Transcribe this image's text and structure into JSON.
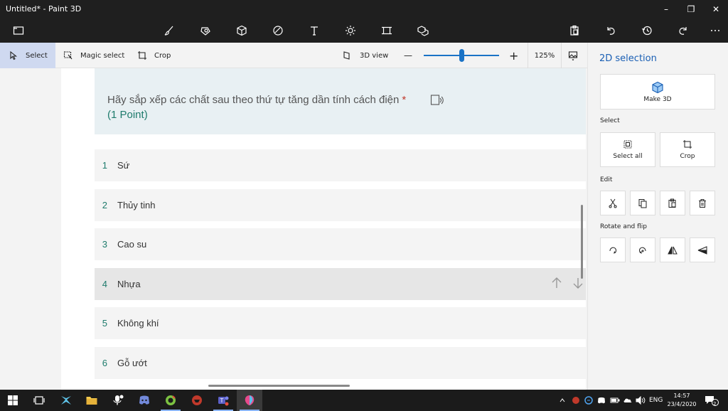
{
  "window": {
    "title": "Untitled* - Paint 3D",
    "minimize": "–",
    "restore": "❐",
    "close": "✕"
  },
  "subtoolbar": {
    "select_label": "Select",
    "magic_select_label": "Magic select",
    "crop_label": "Crop",
    "view3d_label": "3D view",
    "zoom_minus": "—",
    "zoom_plus": "+",
    "zoom_level": "125%",
    "zoom_fraction": 0.5
  },
  "question": {
    "text": "Hãy sắp xếp các chất sau theo thứ tự tăng dần tính cách điện",
    "required_mark": "*",
    "points": "(1 Point)"
  },
  "ranking": [
    {
      "number": "1",
      "label": "Sứ"
    },
    {
      "number": "2",
      "label": "Thủy tinh"
    },
    {
      "number": "3",
      "label": "Cao su"
    },
    {
      "number": "4",
      "label": "Nhựa"
    },
    {
      "number": "5",
      "label": "Không khí"
    },
    {
      "number": "6",
      "label": "Gỗ ướt"
    }
  ],
  "panel": {
    "title": "2D selection",
    "make3d_label": "Make 3D",
    "select_section": "Select",
    "select_all_label": "Select all",
    "crop_label": "Crop",
    "edit_section": "Edit",
    "rotate_section": "Rotate and flip"
  },
  "taskbar": {
    "language": "ENG",
    "time": "14:57",
    "date": "23/4/2020",
    "notification_count": "2"
  },
  "colors": {
    "accent": "#1a73c6",
    "required": "#c0392b",
    "points": "#1e7b6c",
    "question_bg": "#e8f0f3"
  }
}
